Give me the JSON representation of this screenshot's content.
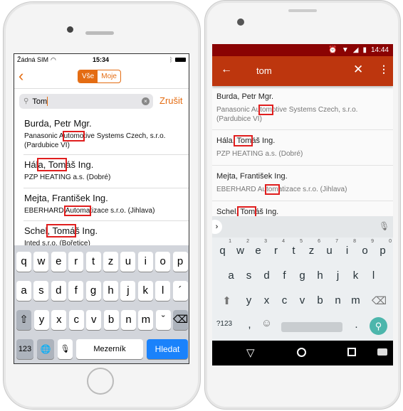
{
  "ios": {
    "status": {
      "carrier": "Žádná SIM",
      "time": "15:34"
    },
    "segments": [
      "Vše",
      "Moje"
    ],
    "search": {
      "value": "Tom",
      "cancel": "Zrušit"
    },
    "rows": [
      {
        "name": [
          "Burda, Petr Mgr.",
          "",
          ""
        ],
        "company": [
          "Panasonic A",
          "utomo",
          "tive Systems Czech, s.r.o."
        ],
        "company2": "(Pardubice VI)"
      },
      {
        "name": [
          "Hál",
          "a, Tom",
          "áš Ing."
        ],
        "company": [
          "PZP HEATING a.s. (Dobré)",
          "",
          ""
        ],
        "company2": ""
      },
      {
        "name": [
          "Mejta, František Ing.",
          "",
          ""
        ],
        "company": [
          "EBERHARD ",
          "Automa",
          "tizace s.r.o. (Jihlava)"
        ],
        "company2": ""
      },
      {
        "name": [
          "Schel",
          ", Tomá",
          "š Ing."
        ],
        "company": [
          "Inted s.r.o. (Bořetice)",
          "",
          ""
        ],
        "company2": ""
      }
    ],
    "keyboard": {
      "row1": [
        "q",
        "w",
        "e",
        "r",
        "t",
        "z",
        "u",
        "i",
        "o",
        "p"
      ],
      "row2": [
        "a",
        "s",
        "d",
        "f",
        "g",
        "h",
        "j",
        "k",
        "l",
        "´"
      ],
      "row3": [
        "y",
        "x",
        "c",
        "v",
        "b",
        "n",
        "m",
        "ˇ"
      ],
      "numbers": "123",
      "space": "Mezerník",
      "search": "Hledat",
      "accent": "#1a82fb"
    }
  },
  "android": {
    "status": {
      "time": "14:44"
    },
    "query": "tom",
    "rows": [
      {
        "name": [
          "Burda, Petr Mgr.",
          "",
          ""
        ],
        "company": [
          "Panasonic Au",
          "tom",
          "otive Systems Czech, s.r.o."
        ],
        "company2": "(Pardubice VI)"
      },
      {
        "name": [
          "Hála,",
          " Tom",
          "áš Ing."
        ],
        "company": [
          "PZP HEATING a.s. (Dobré)",
          "",
          ""
        ],
        "company2": ""
      },
      {
        "name": [
          "Mejta, František Ing.",
          "",
          ""
        ],
        "company": [
          "EBERHARD Au",
          "tom",
          "atizace s.r.o. (Jihlava)"
        ],
        "company2": ""
      },
      {
        "name": [
          "Schel,",
          " Tom",
          "áš Ing."
        ],
        "company": [
          "",
          "",
          ""
        ],
        "company2": ""
      }
    ],
    "keyboard": {
      "row1": [
        "q",
        "w",
        "e",
        "r",
        "t",
        "z",
        "u",
        "i",
        "o",
        "p"
      ],
      "hints": [
        "1",
        "2",
        "3",
        "4",
        "5",
        "6",
        "7",
        "8",
        "9",
        "0"
      ],
      "row2": [
        "a",
        "s",
        "d",
        "f",
        "g",
        "h",
        "j",
        "k",
        "l"
      ],
      "row3": [
        "y",
        "x",
        "c",
        "v",
        "b",
        "n",
        "m"
      ],
      "symbols": "?123",
      "comma": ",",
      "period": ".",
      "accent": "#4db6ac"
    },
    "colors": {
      "statusbar": "#8a0303",
      "toolbar": "#bd360e"
    }
  }
}
